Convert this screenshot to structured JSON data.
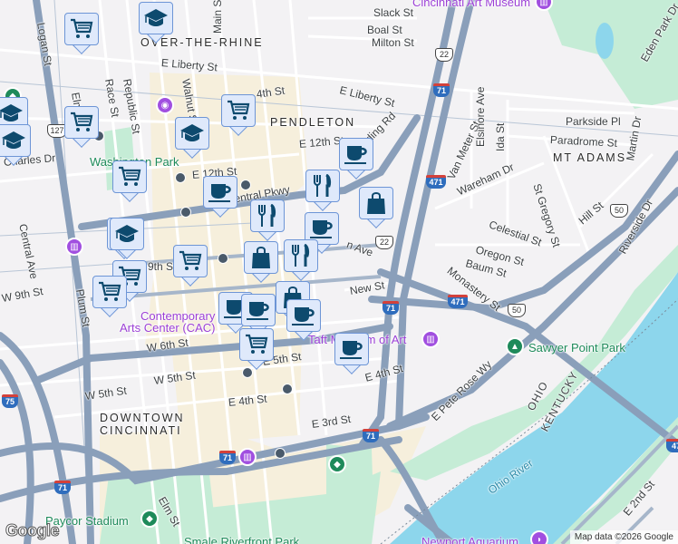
{
  "neighborhoods": {
    "otr": "OVER-THE-RHINE",
    "pendleton": "PENDLETON",
    "mt_adams": "MT ADAMS",
    "downtown1": "DOWNTOWN",
    "downtown2": "CINCINNATI"
  },
  "streets": {
    "logan": "Logan St",
    "main": "Main St",
    "boal": "Boal St",
    "milton": "Milton St",
    "slack": "Slack St",
    "liberty1": "E Liberty St",
    "liberty2": "E Liberty St",
    "elm": "Elm St",
    "race": "Race St",
    "republic": "Republic St",
    "walnut": "Walnut St",
    "fourteenth": "4th St",
    "twelfth1": "E 12th St",
    "twelfth2": "E 12th St",
    "charles": "Charles Dr",
    "central_ave": "Central Ave",
    "central_pkwy": "Central Pkwy",
    "plum": "Plum St",
    "w9th": "W 9th St",
    "ninth": "9th St",
    "w6th": "W 6th St",
    "e5th": "E 5th St",
    "w5th1": "W 5th St",
    "w5th2": "W 5th St",
    "e4th1": "E 4th St",
    "e4th2": "E 4th St",
    "e3rd": "E 3rd St",
    "elm2": "Elm St",
    "reading": "ding Rd",
    "gilbert": "n Ave",
    "van_meter": "Van Meter St",
    "elsinore": "Elsinore Ave",
    "ida": "Ida St",
    "parkside": "Parkside Pl",
    "paradrome": "Paradrome St",
    "martin": "Martin Dr",
    "wareham": "Wareham Dr",
    "st_gregory": "St Gregory St",
    "celestial": "Celestial St",
    "oregon": "Oregon St",
    "baum": "Baum St",
    "hill": "Hill St",
    "riverside": "Riverside Dr",
    "eden_park": "Eden Park Dr",
    "monastery": "Monastery St",
    "new": "New St",
    "pete_rose": "E Pete Rose Wy",
    "e2nd": "E 2nd St"
  },
  "pois": {
    "art_museum": "Cincinnati Art Museum",
    "cac1": "Contemporary",
    "cac2": "Arts Center (CAC)",
    "taft": "Taft Museum of Art",
    "washington_park": "Washington Park",
    "sawyer": "Sawyer Point Park",
    "paycor": "Paycor Stadium",
    "smale": "Smale Riverfront Park",
    "aquarium": "Newport Aquarium"
  },
  "water": {
    "river": "Ohio River",
    "state1": "OHIO",
    "state2": "KENTUCKY"
  },
  "shields": {
    "i71": "71",
    "i471": "471",
    "us22": "22",
    "us50": "50",
    "us127": "127",
    "i75": "75",
    "i47": "47"
  },
  "markers": [
    "grocery-cart",
    "graduation-cap",
    "grocery-cart",
    "graduation-cap",
    "graduation-cap",
    "grocery-cart",
    "graduation-cap",
    "grocery-cart",
    "graduation-cap",
    "coffee-cup",
    "graduation-cap",
    "grocery-cart",
    "grocery-cart",
    "grocery-cart",
    "coffee-cup",
    "fork-knife",
    "shopping-bag",
    "fork-knife",
    "coffee-cup",
    "shopping-bag",
    "fork-knife",
    "shopping-bag",
    "coffee-cup",
    "coffee-cup",
    "coffee-cup",
    "grocery-cart",
    "coffee-cup"
  ],
  "colors": {
    "marker_fill": "#dfe9fb",
    "marker_border": "#6d95d6",
    "icon": "#0d4a6e",
    "highway": "#8a9fba",
    "water": "#8dd6ec",
    "park": "#c5ecd6"
  },
  "footer": {
    "credit": "Map data ©2026 Google",
    "logo": "Google"
  }
}
